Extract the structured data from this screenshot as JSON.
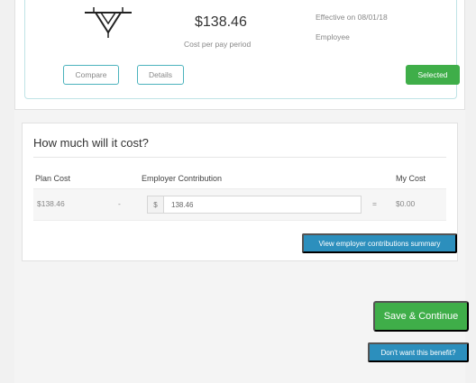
{
  "plan": {
    "price": "$138.46",
    "price_sub": "Cost per pay period",
    "effective": "Effective on 08/01/18",
    "coverage": "Employee",
    "compare_label": "Compare",
    "details_label": "Details",
    "selected_label": "Selected"
  },
  "cost": {
    "title": "How much will it cost?",
    "headers": {
      "plan_cost": "Plan Cost",
      "employer_contribution": "Employer Contribution",
      "my_cost": "My Cost"
    },
    "row": {
      "plan_cost": "$138.46",
      "dash": "-",
      "currency": "$",
      "employer_value": "138.46",
      "equals": "=",
      "my_cost": "$0.00"
    },
    "summary_label": "View employer contributions summary"
  },
  "actions": {
    "save_label": "Save & Continue",
    "dont_want_label": "Don't want this benefit?"
  },
  "colors": {
    "green": "#3fae49",
    "blue": "#2c8fbd",
    "teal": "#4bb3bd"
  }
}
